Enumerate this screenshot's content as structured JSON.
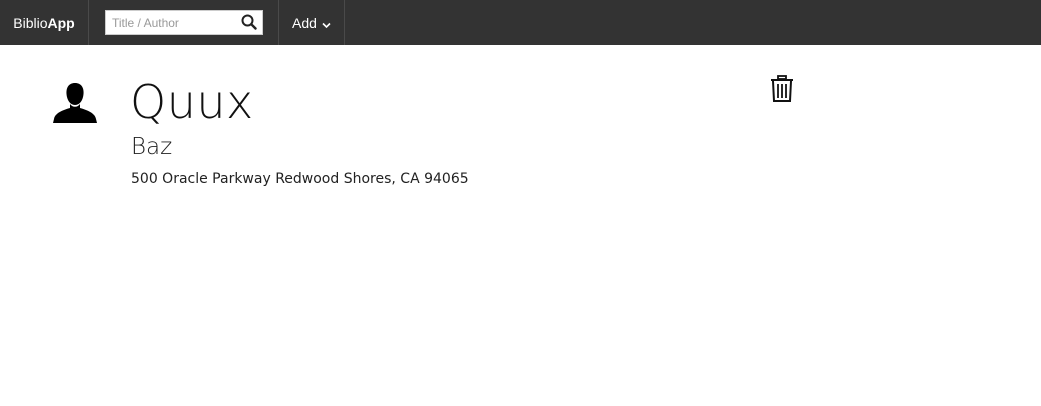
{
  "navbar": {
    "brand_light": "Biblio",
    "brand_bold": "App",
    "search": {
      "placeholder": "Title / Author",
      "value": "",
      "icon": "search-icon"
    },
    "add_menu": {
      "label": "Add",
      "icon": "chevron-down-icon"
    }
  },
  "profile": {
    "avatar_icon": "user-silhouette-icon",
    "name": "Quux",
    "subtitle": "Baz",
    "address": "500 Oracle Parkway Redwood Shores, CA 94065",
    "delete_icon": "trash-icon"
  },
  "colors": {
    "navbar_bg": "#333333",
    "navbar_text": "#ffffff",
    "page_bg": "#ffffff"
  }
}
